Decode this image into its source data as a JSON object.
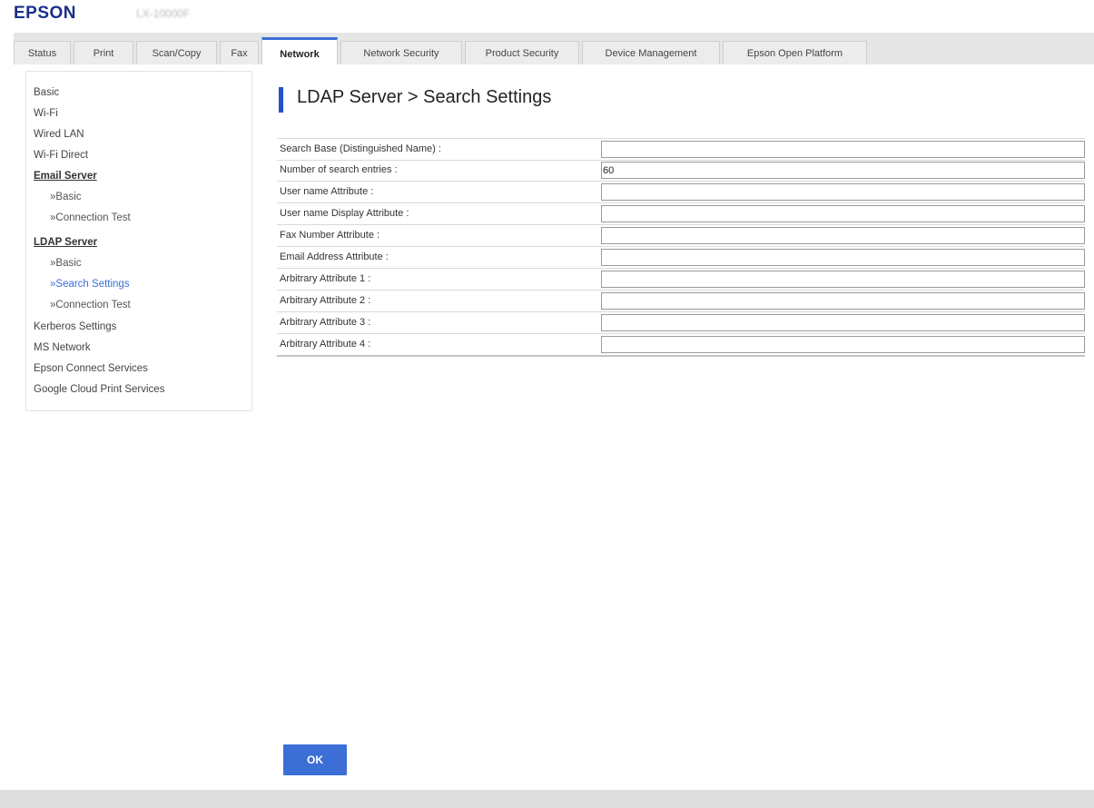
{
  "header": {
    "brand": "EPSON",
    "model": "LX-10000F"
  },
  "tabs": [
    {
      "label": "Status",
      "active": false
    },
    {
      "label": "Print",
      "active": false
    },
    {
      "label": "Scan/Copy",
      "active": false
    },
    {
      "label": "Fax",
      "active": false
    },
    {
      "label": "Network",
      "active": true
    },
    {
      "label": "Network Security",
      "active": false
    },
    {
      "label": "Product Security",
      "active": false
    },
    {
      "label": "Device Management",
      "active": false
    },
    {
      "label": "Epson Open Platform",
      "active": false
    }
  ],
  "sidebar": {
    "items": [
      {
        "label": "Basic",
        "kind": "item"
      },
      {
        "label": "Wi-Fi",
        "kind": "item"
      },
      {
        "label": "Wired LAN",
        "kind": "item"
      },
      {
        "label": "Wi-Fi Direct",
        "kind": "item"
      },
      {
        "label": "Email Server",
        "kind": "section"
      },
      {
        "label": "»Basic",
        "kind": "sub"
      },
      {
        "label": "»Connection Test",
        "kind": "sub"
      },
      {
        "label": "LDAP Server",
        "kind": "section"
      },
      {
        "label": "»Basic",
        "kind": "sub"
      },
      {
        "label": "»Search Settings",
        "kind": "sub-active"
      },
      {
        "label": "»Connection Test",
        "kind": "sub"
      },
      {
        "label": "Kerberos Settings",
        "kind": "item"
      },
      {
        "label": "MS Network",
        "kind": "item"
      },
      {
        "label": "Epson Connect Services",
        "kind": "item"
      },
      {
        "label": "Google Cloud Print Services",
        "kind": "item"
      }
    ]
  },
  "page": {
    "title": "LDAP Server > Search Settings"
  },
  "form": {
    "fields": [
      {
        "label": "Search Base (Distinguished Name) :",
        "value": ""
      },
      {
        "label": "Number of search entries :",
        "value": "60"
      },
      {
        "label": "User name Attribute :",
        "value": ""
      },
      {
        "label": "User name Display Attribute :",
        "value": ""
      },
      {
        "label": "Fax Number Attribute :",
        "value": ""
      },
      {
        "label": "Email Address Attribute :",
        "value": ""
      },
      {
        "label": "Arbitrary Attribute 1 :",
        "value": ""
      },
      {
        "label": "Arbitrary Attribute 2 :",
        "value": ""
      },
      {
        "label": "Arbitrary Attribute 3 :",
        "value": ""
      },
      {
        "label": "Arbitrary Attribute 4 :",
        "value": ""
      }
    ]
  },
  "actions": {
    "ok_label": "OK"
  },
  "colors": {
    "brand": "#1a2f8a",
    "accent": "#3a6fd8",
    "title_bar": "#2451c9",
    "ok_button": "#3b6fd6"
  }
}
